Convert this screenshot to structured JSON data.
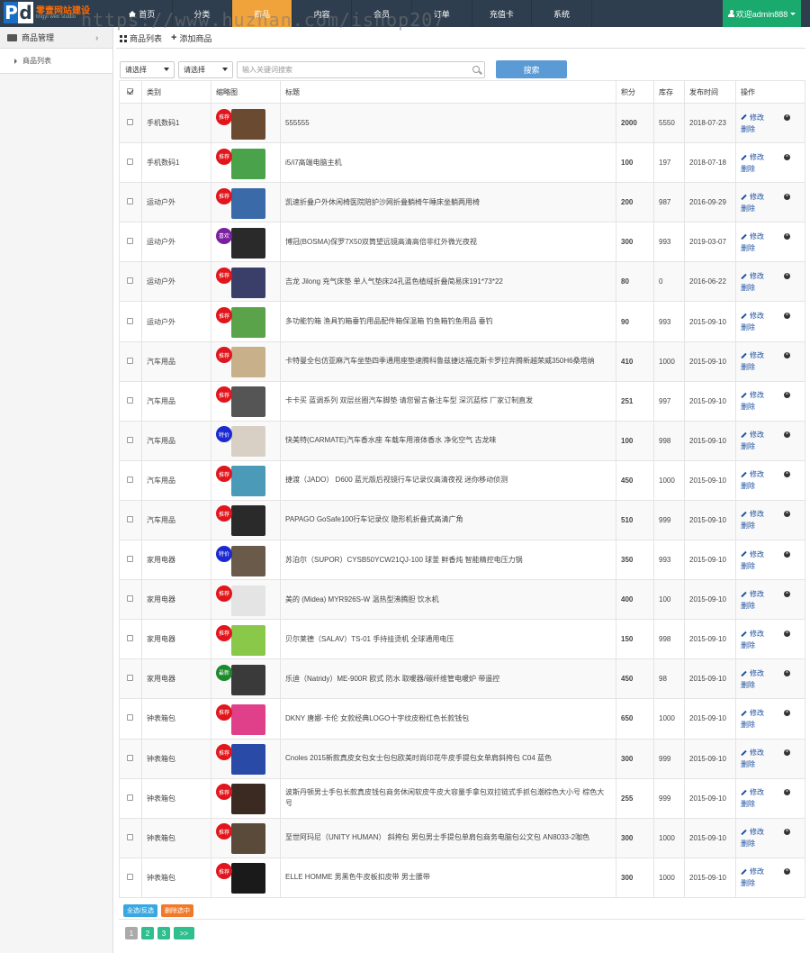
{
  "brand": {
    "logo_p": "P",
    "logo_d": "d",
    "name": "零壹网站建设",
    "sub": "lingyi web studio"
  },
  "watermark": "https://www.huzhan.com/ishop207",
  "nav": [
    {
      "label": "首页"
    },
    {
      "label": "分类"
    },
    {
      "label": "商品"
    },
    {
      "label": "内容"
    },
    {
      "label": "会员"
    },
    {
      "label": "订单"
    },
    {
      "label": "充值卡"
    },
    {
      "label": "系统"
    }
  ],
  "user": {
    "label": "欢迎admin888"
  },
  "sidebar": {
    "head": "商品管理",
    "chevron": "›",
    "item": "商品列表"
  },
  "tabs": {
    "list": "商品列表",
    "add": "添加商品"
  },
  "filters": {
    "select1": "请选择",
    "select2": "请选择",
    "search_placeholder": "输入关键词搜索",
    "search_button": "搜索"
  },
  "table": {
    "headers": {
      "category": "类别",
      "thumb": "缩略图",
      "title": "标题",
      "points": "积分",
      "stock": "库存",
      "date": "发布时间",
      "ops": "操作"
    },
    "edit_label": "修改",
    "delete_label": "删除",
    "rows": [
      {
        "category": "手机数码1",
        "badge": "推荐",
        "badge_color": "#e0161c",
        "thumb_color": "#6b4a32",
        "title": "555555",
        "points": "2000",
        "stock": "5550",
        "date": "2018-07-23"
      },
      {
        "category": "手机数码1",
        "badge": "推荐",
        "badge_color": "#e0161c",
        "thumb_color": "#4aa34a",
        "title": "i5/i7高端电脑主机",
        "points": "100",
        "stock": "197",
        "date": "2018-07-18"
      },
      {
        "category": "运动户外",
        "badge": "推荐",
        "badge_color": "#e0161c",
        "thumb_color": "#3a6aa8",
        "title": "凯速折叠户外休闲椅医院陪护沙网折叠躺椅午睡床坐躺两用椅",
        "points": "200",
        "stock": "987",
        "date": "2016-09-29"
      },
      {
        "category": "运动户外",
        "badge": "喜欢",
        "badge_color": "#7b1fa2",
        "thumb_color": "#2a2a2a",
        "title": "博冠(BOSMA)保罗7X50双筒望远镜高清高倍非红外微光夜视",
        "points": "300",
        "stock": "993",
        "date": "2019-03-07"
      },
      {
        "category": "运动户外",
        "badge": "推荐",
        "badge_color": "#e0161c",
        "thumb_color": "#3a3f6a",
        "title": "吉龙 Jilong 充气床垫 单人气垫床24孔蓝色植绒折叠简易床191*73*22",
        "points": "80",
        "stock": "0",
        "date": "2016-06-22"
      },
      {
        "category": "运动户外",
        "badge": "推荐",
        "badge_color": "#e0161c",
        "thumb_color": "#5aa34a",
        "title": "多功能钓箱 渔具钓箱垂钓用品配件箱保温箱 钓鱼箱钓鱼用品 垂钓",
        "points": "90",
        "stock": "993",
        "date": "2015-09-10"
      },
      {
        "category": "汽车用品",
        "badge": "推荐",
        "badge_color": "#e0161c",
        "thumb_color": "#c8b08a",
        "title": "卡特曼全包仿亚麻汽车坐垫四季通用座垫速腾科鲁兹捷达福克斯卡罗拉奔腾新越荣威350H6桑塔纳",
        "points": "410",
        "stock": "1000",
        "date": "2015-09-10"
      },
      {
        "category": "汽车用品",
        "badge": "推荐",
        "badge_color": "#e0161c",
        "thumb_color": "#555555",
        "title": "卡卡买 蓝调系列 双层丝圈汽车脚垫 请您留言备注车型 深沉蓝棕 厂家订制直发",
        "points": "251",
        "stock": "997",
        "date": "2015-09-10"
      },
      {
        "category": "汽车用品",
        "badge": "特价",
        "badge_color": "#1a2ad0",
        "thumb_color": "#d8d0c4",
        "title": "快美特(CARMATE)汽车香水座 车载车用液体香水 净化空气 古龙味",
        "points": "100",
        "stock": "998",
        "date": "2015-09-10"
      },
      {
        "category": "汽车用品",
        "badge": "推荐",
        "badge_color": "#e0161c",
        "thumb_color": "#4a9ab8",
        "title": "捷渡（JADO） D600 蓝光版后视镜行车记录仪高清夜视 迷你移动侦测",
        "points": "450",
        "stock": "1000",
        "date": "2015-09-10"
      },
      {
        "category": "汽车用品",
        "badge": "推荐",
        "badge_color": "#e0161c",
        "thumb_color": "#2a2a2a",
        "title": "PAPAGO GoSafe100行车记录仪 隐形机折叠式高清广角",
        "points": "510",
        "stock": "999",
        "date": "2015-09-10"
      },
      {
        "category": "家用电器",
        "badge": "特价",
        "badge_color": "#1a2ad0",
        "thumb_color": "#6a5a4a",
        "title": "苏泊尔（SUPOR）CYSB50YCW21QJ-100 球釜 鲜香炖 智能精控电压力锅",
        "points": "350",
        "stock": "993",
        "date": "2015-09-10"
      },
      {
        "category": "家用电器",
        "badge": "推荐",
        "badge_color": "#e0161c",
        "thumb_color": "#e4e4e4",
        "title": "美的 (Midea) MYR926S-W 温热型沸腾胆 饮水机",
        "points": "400",
        "stock": "100",
        "date": "2015-09-10"
      },
      {
        "category": "家用电器",
        "badge": "推荐",
        "badge_color": "#e0161c",
        "thumb_color": "#8ac84a",
        "title": "贝尔莱德（SALAV）TS-01 手持挂烫机 全球通用电压",
        "points": "150",
        "stock": "998",
        "date": "2015-09-10"
      },
      {
        "category": "家用电器",
        "badge": "最新",
        "badge_color": "#1a8a2a",
        "thumb_color": "#3a3a3a",
        "title": "乐迪（Natridy）ME-900R 欧式 防水 取暖器/碳纤维管电暖炉 带遥控",
        "points": "450",
        "stock": "98",
        "date": "2015-09-10"
      },
      {
        "category": "钟表箱包",
        "badge": "推荐",
        "badge_color": "#e0161c",
        "thumb_color": "#e0408a",
        "title": "DKNY 唐娜·卡伦 女款经典LOGO十字纹皮粉红色长款钱包",
        "points": "650",
        "stock": "1000",
        "date": "2015-09-10"
      },
      {
        "category": "钟表箱包",
        "badge": "推荐",
        "badge_color": "#e0161c",
        "thumb_color": "#2a4aa8",
        "title": "Cnoles 2015新款真皮女包女士包包欧美时尚印花牛皮手提包女单肩斜挎包 C04 蓝色",
        "points": "300",
        "stock": "999",
        "date": "2015-09-10"
      },
      {
        "category": "钟表箱包",
        "badge": "推荐",
        "badge_color": "#e0161c",
        "thumb_color": "#3a2a22",
        "title": "波斯丹顿男士手包长款真皮钱包商务休闲软皮牛皮大容量手拿包双拉链式手抓包潮棕色大小号 棕色大号",
        "points": "255",
        "stock": "999",
        "date": "2015-09-10"
      },
      {
        "category": "钟表箱包",
        "badge": "推荐",
        "badge_color": "#e0161c",
        "thumb_color": "#5a4a3a",
        "title": "至世阿玛尼（UNITY HUMAN） 斜挎包 男包男士手提包单肩包商务电脑包公文包 AN8033-2咖色",
        "points": "300",
        "stock": "1000",
        "date": "2015-09-10"
      },
      {
        "category": "钟表箱包",
        "badge": "推荐",
        "badge_color": "#e0161c",
        "thumb_color": "#1a1a1a",
        "title": "ELLE HOMME 男黑色牛皮板扣皮带 男士腰带",
        "points": "300",
        "stock": "1000",
        "date": "2015-09-10"
      }
    ]
  },
  "footer": {
    "select_all": "全选/反选",
    "delete_selected": "删除选中",
    "select_all_color": "#3aa8e0",
    "delete_color": "#f07a2a"
  },
  "pager": {
    "pages": [
      "1",
      "2",
      "3"
    ],
    "next": ">>",
    "current": "1"
  }
}
